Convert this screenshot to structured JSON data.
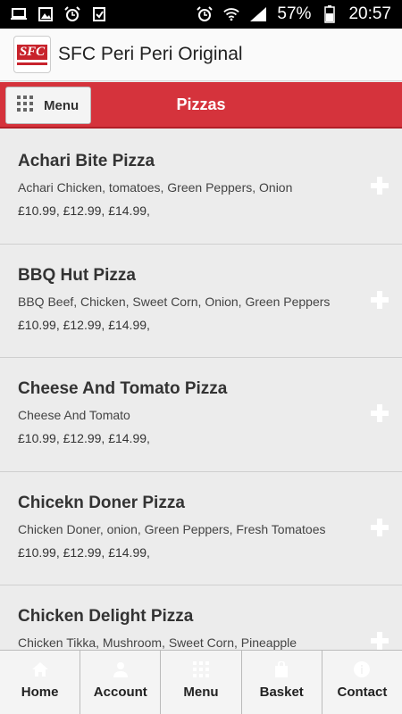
{
  "status_bar": {
    "battery": "57%",
    "time": "20:57"
  },
  "app": {
    "title": "SFC Peri Peri Original",
    "logo_text": "SFC"
  },
  "category_bar": {
    "menu_label": "Menu",
    "title": "Pizzas"
  },
  "items": [
    {
      "name": "Achari Bite Pizza",
      "description": "Achari Chicken, tomatoes, Green Peppers, Onion",
      "prices": "£10.99, £12.99, £14.99,"
    },
    {
      "name": "BBQ Hut Pizza",
      "description": "BBQ Beef, Chicken, Sweet Corn, Onion, Green Peppers",
      "prices": "£10.99, £12.99, £14.99,"
    },
    {
      "name": "Cheese And Tomato Pizza",
      "description": "Cheese And Tomato",
      "prices": "£10.99, £12.99, £14.99,"
    },
    {
      "name": "Chicekn Doner Pizza",
      "description": "Chicken Doner, onion, Green Peppers, Fresh Tomatoes",
      "prices": "£10.99, £12.99, £14.99,"
    },
    {
      "name": "Chicken Delight Pizza",
      "description": "Chicken Tikka, Mushroom, Sweet Corn, Pineapple",
      "prices": ""
    }
  ],
  "bottom_nav": {
    "home": "Home",
    "account": "Account",
    "menu": "Menu",
    "basket": "Basket",
    "contact": "Contact"
  },
  "colors": {
    "accent_red": "#d5333c",
    "status_bar": "#000000"
  }
}
